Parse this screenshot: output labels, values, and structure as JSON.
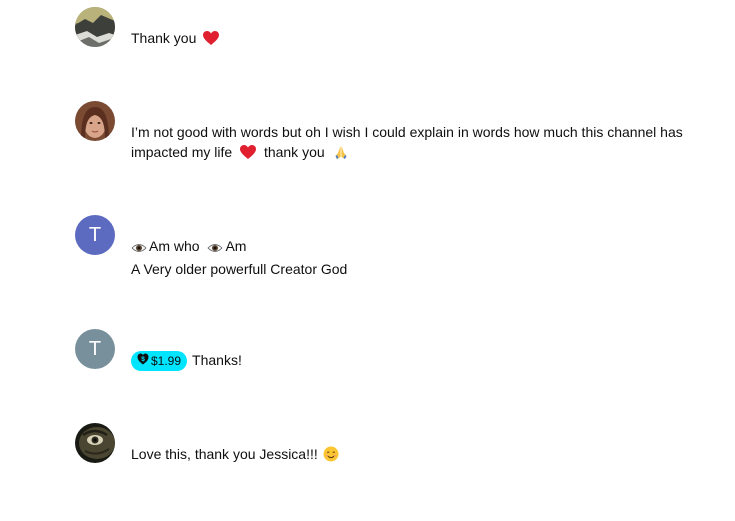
{
  "comments": [
    {
      "avatar": "photo-avatar-landscape",
      "lines": [
        "Thank you"
      ],
      "trailing_emoji": "red-heart-emoji"
    },
    {
      "avatar": "photo-avatar-woman",
      "lines": [
        "I’m not good with words but oh I wish I could explain in words how much this channel has",
        "impacted my life",
        "thank you"
      ],
      "emojis": [
        "red-heart-emoji",
        "folded-hands-emoji"
      ]
    },
    {
      "avatar": "letter-avatar",
      "avatar_letter": "T",
      "avatar_color": "#5c6bc0",
      "line1_parts": [
        "Am who",
        "Am"
      ],
      "line2": "A Very older powerfull Creator God",
      "emojis": [
        "eye-emoji",
        "eye-emoji"
      ]
    },
    {
      "avatar": "letter-avatar",
      "avatar_letter": "T",
      "avatar_color": "#78909c",
      "thanks_amount": "$1.99",
      "thanks_chip_color": "#00e5ff",
      "text": "Thanks!"
    },
    {
      "avatar": "photo-avatar-face",
      "text": "Love this, thank you Jessica!!!",
      "trailing_emoji": "smiling-face-emoji"
    }
  ]
}
